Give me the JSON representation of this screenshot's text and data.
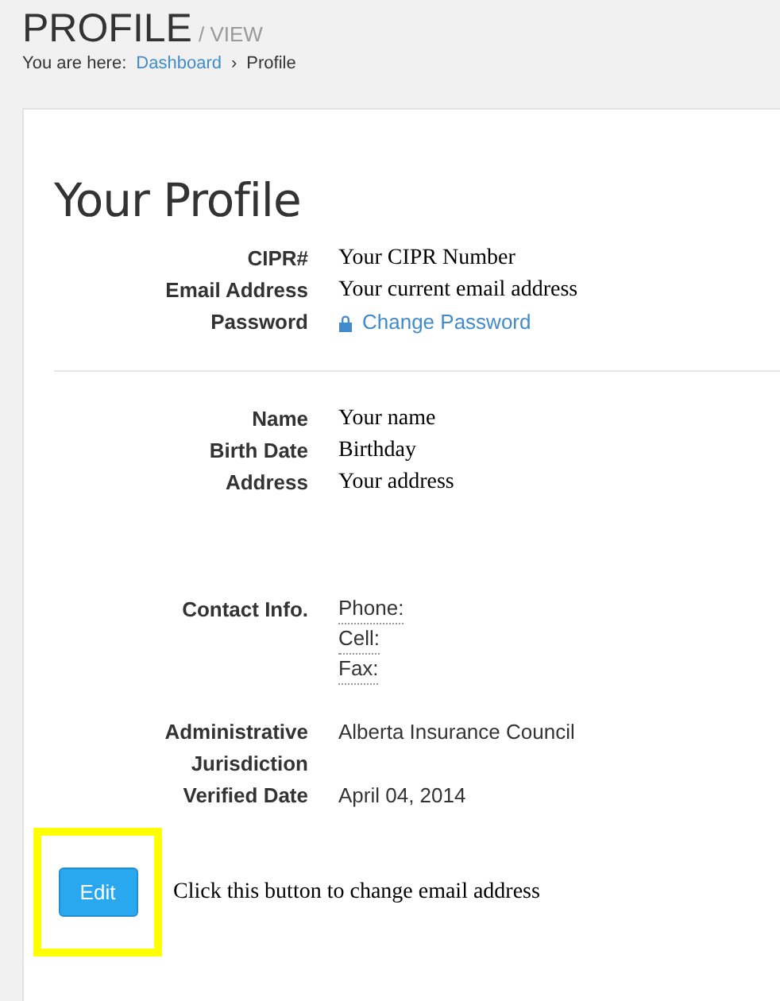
{
  "header": {
    "title": "PROFILE",
    "subtitle": "/ VIEW",
    "breadcrumb": {
      "prefix": "You are here:",
      "separator": "›",
      "items": [
        {
          "label": "Dashboard",
          "kind": "link"
        },
        {
          "label": "Profile",
          "kind": "current"
        }
      ]
    }
  },
  "card": {
    "heading": "Your Profile",
    "sections": [
      {
        "divider_after": true,
        "rows": [
          {
            "label": "CIPR#",
            "kind": "serif",
            "value": "Your CIPR Number"
          },
          {
            "label": "Email Address",
            "kind": "serif",
            "value": "Your current email address"
          },
          {
            "label": "Password",
            "kind": "link",
            "value": "Change Password"
          }
        ]
      },
      {
        "divider_after": false,
        "rows": [
          {
            "label": "Name",
            "kind": "serif",
            "value": "Your name"
          },
          {
            "label": "Birth Date",
            "kind": "serif",
            "value": "Birthday"
          },
          {
            "label": "Address",
            "kind": "serif",
            "value": "Your address"
          }
        ]
      },
      {
        "divider_after": false,
        "rows": [
          {
            "label": "Contact Info.",
            "kind": "lines",
            "values": [
              "Phone:",
              "Cell:",
              "Fax:"
            ]
          }
        ]
      },
      {
        "divider_after": false,
        "rows": [
          {
            "label": "Administrative Jurisdiction",
            "kind": "sans",
            "value": "Alberta Insurance Council"
          },
          {
            "label": "Verified Date",
            "kind": "sans",
            "value": "April 04, 2014"
          }
        ]
      }
    ],
    "edit_button": {
      "label": "Edit",
      "highlighted": true
    },
    "note": "Click this button to change email address"
  }
}
